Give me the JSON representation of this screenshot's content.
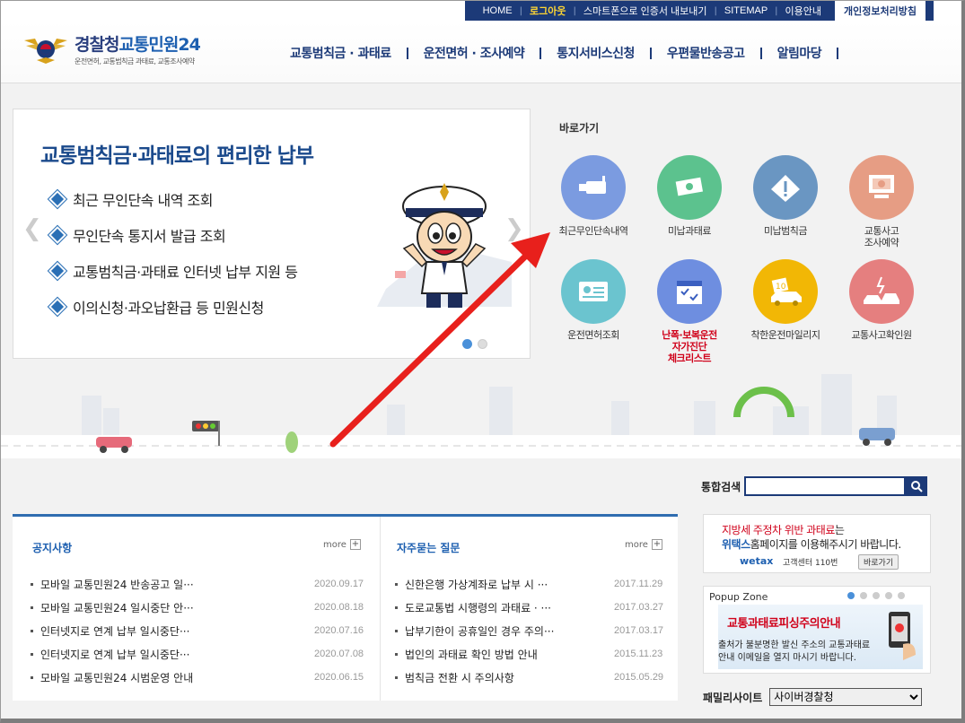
{
  "util": {
    "home": "HOME",
    "logout": "로그아웃",
    "export_cert": "스마트폰으로 인증서 내보내기",
    "sitemap": "SITEMAP",
    "guide": "이용안내",
    "privacy": "개인정보처리방침"
  },
  "logo": {
    "brand_a": "경찰청",
    "brand_b": "교통민원24",
    "sub": "운전면허, 교통범칙금 과태료, 교통조사예약"
  },
  "gnb": [
    "교통범칙금 · 과태료",
    "운전면허 · 조사예약",
    "통지서비스신청",
    "우편물반송공고",
    "알림마당"
  ],
  "banner": {
    "title": "교통범칙금·과태료의 편리한 납부",
    "items": [
      "최근 무인단속 내역 조회",
      "무인단속 통지서 발급 조회",
      "교통범칙금·과태료 인터넷 납부 지원 등",
      "이의신청·과오납환급 등 민원신청"
    ]
  },
  "quick": {
    "label": "바로가기",
    "items": [
      {
        "line1": "최근무인단속내역",
        "line2": "",
        "line3": "",
        "color": "#7b9be0",
        "icon": "camera-icon"
      },
      {
        "line1": "미납과태료",
        "line2": "",
        "line3": "",
        "color": "#5cc28e",
        "icon": "money-icon"
      },
      {
        "line1": "미납범칙금",
        "line2": "",
        "line3": "",
        "color": "#6a96c2",
        "icon": "warning-icon"
      },
      {
        "line1": "교통사고",
        "line2": "조사예약",
        "line3": "",
        "color": "#e69d84",
        "icon": "computer-icon"
      },
      {
        "line1": "운전면허조회",
        "line2": "",
        "line3": "",
        "color": "#6bc4cf",
        "icon": "license-icon"
      },
      {
        "line1": "난폭·보복운전",
        "line2": "자가진단",
        "line3": "체크리스트",
        "color": "#6e8ee0",
        "icon": "calendar-check-icon"
      },
      {
        "line1": "착한운전마일리지",
        "line2": "",
        "line3": "",
        "color": "#f2b705",
        "icon": "car-mileage-icon"
      },
      {
        "line1": "교통사고확인원",
        "line2": "",
        "line3": "",
        "color": "#e57f7f",
        "icon": "car-accident-icon"
      }
    ]
  },
  "search": {
    "label": "통합검색",
    "value": ""
  },
  "notice": {
    "title": "공지사항",
    "more": "more",
    "rows": [
      {
        "text": "모바일 교통민원24 반송공고 일···",
        "date": "2020.09.17"
      },
      {
        "text": "모바일 교통민원24 일시중단 안···",
        "date": "2020.08.18"
      },
      {
        "text": "인터넷지로 연계 납부 일시중단···",
        "date": "2020.07.16"
      },
      {
        "text": "인터넷지로 연계 납부 일시중단···",
        "date": "2020.07.08"
      },
      {
        "text": "모바일 교통민원24 시범운영 안내",
        "date": "2020.06.15"
      }
    ]
  },
  "faq": {
    "title": "자주묻는 질문",
    "more": "more",
    "rows": [
      {
        "text": "신한은행 가상계좌로 납부 시 ···",
        "date": "2017.11.29"
      },
      {
        "text": "도로교통법 시행령의 과태료 · ···",
        "date": "2017.03.27"
      },
      {
        "text": "납부기한이 공휴일인 경우 주의···",
        "date": "2017.03.17"
      },
      {
        "text": "법인의 과태료 확인 방법 안내",
        "date": "2015.11.23"
      },
      {
        "text": "범칙금 전환 시 주의사항",
        "date": "2015.05.29"
      }
    ]
  },
  "ad": {
    "l1_red": "지방세 주정차 위반 과태료",
    "l1_rest": "는",
    "l2_blue": "위택스",
    "l2_rest": "홈페이지를 이용해주시기 바랍니다.",
    "wetax": "wetax",
    "callcenter": "고객센터 110번",
    "go": "바로가기"
  },
  "popup": {
    "header": "Popup Zone",
    "title": "교통과태료피싱주의안내",
    "body1": "출처가 불분명한 발신 주소의 교통과태료",
    "body2": "안내 이메일을 열지 마시기 바랍니다."
  },
  "family": {
    "label": "패밀리사이트",
    "selected": "사이버경찰청"
  },
  "colors": {
    "navy": "#1c3a78",
    "accent_red": "#d0021b",
    "blue": "#1d5fb0"
  }
}
